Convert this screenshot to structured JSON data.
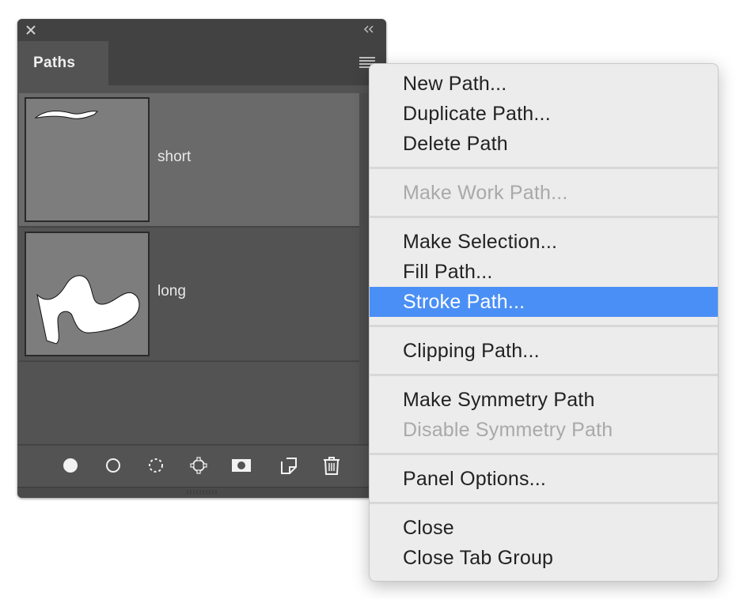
{
  "panel": {
    "tab_label": "Paths",
    "paths": [
      {
        "name": "short",
        "selected": true
      },
      {
        "name": "long",
        "selected": false
      }
    ],
    "footer_icons": [
      "fill-path-icon",
      "stroke-path-icon",
      "load-selection-icon",
      "make-work-path-icon",
      "add-mask-icon",
      "new-path-icon",
      "delete-path-icon"
    ]
  },
  "menu": {
    "items": [
      {
        "label": "New Path...",
        "state": "enabled"
      },
      {
        "label": "Duplicate Path...",
        "state": "enabled"
      },
      {
        "label": "Delete Path",
        "state": "enabled"
      },
      {
        "label": "Make Work Path...",
        "state": "disabled"
      },
      {
        "label": "Make Selection...",
        "state": "enabled"
      },
      {
        "label": "Fill Path...",
        "state": "enabled"
      },
      {
        "label": "Stroke Path...",
        "state": "highlighted"
      },
      {
        "label": "Clipping Path...",
        "state": "enabled"
      },
      {
        "label": "Make Symmetry Path",
        "state": "enabled"
      },
      {
        "label": "Disable Symmetry Path",
        "state": "disabled"
      },
      {
        "label": "Panel Options...",
        "state": "enabled"
      },
      {
        "label": "Close",
        "state": "enabled"
      },
      {
        "label": "Close Tab Group",
        "state": "enabled"
      }
    ]
  },
  "colors": {
    "highlight": "#4a8ff5",
    "panel_bg": "#535353",
    "selected_row": "#6a6a6a",
    "menu_bg": "#ececec",
    "disabled_text": "#a9a9a9"
  }
}
